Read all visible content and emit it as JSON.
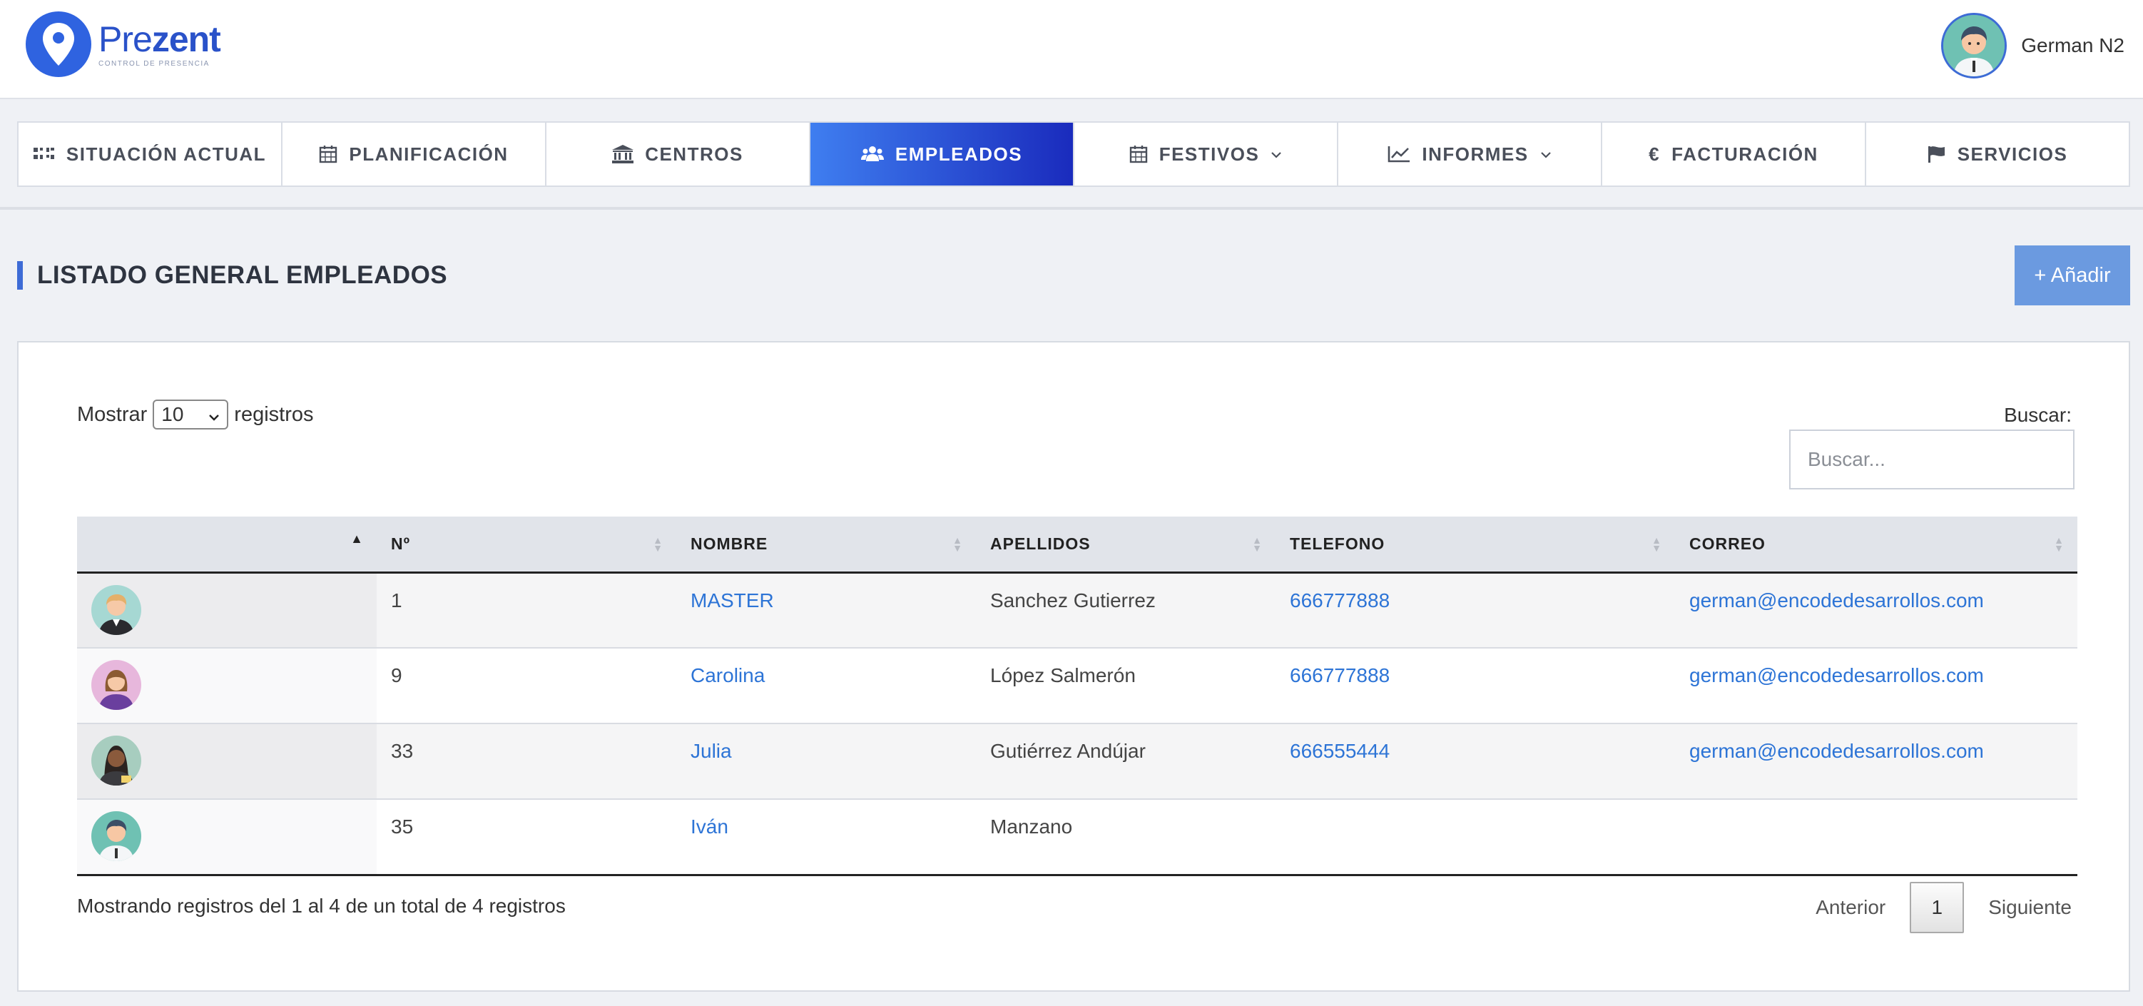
{
  "brand": {
    "name_prefix": "Pre",
    "name_suffix": "zent",
    "tagline": "CONTROL DE PRESENCIA",
    "color": "#2f63e0"
  },
  "user": {
    "name": "German N2"
  },
  "nav": {
    "items": [
      {
        "label": "SITUACIÓN ACTUAL",
        "icon": "grid-icon"
      },
      {
        "label": "PLANIFICACIÓN",
        "icon": "calendar-icon"
      },
      {
        "label": "CENTROS",
        "icon": "bank-icon"
      },
      {
        "label": "EMPLEADOS",
        "icon": "users-icon",
        "active": true
      },
      {
        "label": "FESTIVOS",
        "icon": "calendar-icon",
        "dropdown": true
      },
      {
        "label": "INFORMES",
        "icon": "line-chart-icon",
        "dropdown": true
      },
      {
        "label": "FACTURACIÓN",
        "icon": "euro-icon"
      },
      {
        "label": "SERVICIOS",
        "icon": "flag-icon"
      }
    ],
    "active_gradient": [
      "#3f7ef0",
      "#1a2bbd"
    ]
  },
  "page": {
    "title": "LISTADO GENERAL EMPLEADOS",
    "add_label": "+ Añadir",
    "accent": "#3d6bd6"
  },
  "table_controls": {
    "show_prefix": "Mostrar",
    "show_value": "10",
    "show_suffix": "registros",
    "search_label": "Buscar:",
    "search_placeholder": "Buscar..."
  },
  "table": {
    "columns": [
      "",
      "Nº",
      "NOMBRE",
      "APELLIDOS",
      "TELEFONO",
      "CORREO"
    ],
    "rows": [
      {
        "avatar": "man-blond-avatar",
        "num": "1",
        "nombre": "MASTER",
        "apellidos": "Sanchez Gutierrez",
        "telefono": "666777888",
        "correo": "german@encodedesarrollos.com"
      },
      {
        "avatar": "woman-purple-avatar",
        "num": "9",
        "nombre": "Carolina",
        "apellidos": "López Salmerón",
        "telefono": "666777888",
        "correo": "german@encodedesarrollos.com"
      },
      {
        "avatar": "woman-dark-avatar",
        "num": "33",
        "nombre": "Julia",
        "apellidos": "Gutiérrez Andújar",
        "telefono": "666555444",
        "correo": "german@encodedesarrollos.com"
      },
      {
        "avatar": "man-teal-avatar",
        "num": "35",
        "nombre": "Iván",
        "apellidos": "Manzano",
        "telefono": "",
        "correo": ""
      }
    ]
  },
  "footer": {
    "info": "Mostrando registros del 1 al 4 de un total de 4 registros",
    "prev_label": "Anterior",
    "page": "1",
    "next_label": "Siguiente"
  },
  "colors": {
    "link": "#2d74d6",
    "background": "#eff1f5",
    "add_button": "#6b9ae0"
  }
}
